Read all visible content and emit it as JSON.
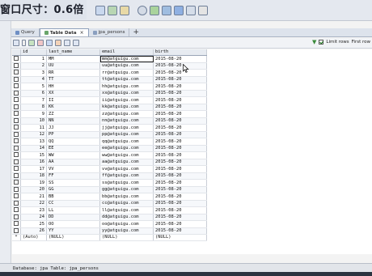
{
  "overlay": {
    "text": "窗口尺寸：0.6倍"
  },
  "tabs": [
    {
      "label": "Query",
      "active": false
    },
    {
      "label": "Table Data",
      "active": true
    },
    {
      "label": "jpa_persons",
      "active": false
    }
  ],
  "grid_toolbar": {
    "limit_label": "Limit rows",
    "first_row_label": "First row"
  },
  "table": {
    "columns": [
      "id",
      "last_name",
      "email",
      "birth"
    ],
    "rows": [
      [
        "1",
        "MM",
        "mm@atguigu.com",
        "2015-08-20"
      ],
      [
        "2",
        "UU",
        "uu@atguigu.com",
        "2015-08-20"
      ],
      [
        "3",
        "RR",
        "rr@atguigu.com",
        "2015-08-20"
      ],
      [
        "4",
        "TT",
        "tt@atguigu.com",
        "2015-08-20"
      ],
      [
        "5",
        "HH",
        "hh@atguigu.com",
        "2015-08-20"
      ],
      [
        "6",
        "XX",
        "xx@atguigu.com",
        "2015-08-20"
      ],
      [
        "7",
        "II",
        "ii@atguigu.com",
        "2015-08-20"
      ],
      [
        "8",
        "KK",
        "kk@atguigu.com",
        "2015-08-20"
      ],
      [
        "9",
        "ZZ",
        "zz@atguigu.com",
        "2015-08-20"
      ],
      [
        "10",
        "NN",
        "nn@atguigu.com",
        "2015-08-20"
      ],
      [
        "11",
        "JJ",
        "jj@atguigu.com",
        "2015-08-20"
      ],
      [
        "12",
        "PP",
        "pp@atguigu.com",
        "2015-08-20"
      ],
      [
        "13",
        "QQ",
        "qq@atguigu.com",
        "2015-08-20"
      ],
      [
        "14",
        "EE",
        "ee@atguigu.com",
        "2015-08-20"
      ],
      [
        "15",
        "WW",
        "ww@atguigu.com",
        "2015-08-20"
      ],
      [
        "16",
        "AA",
        "aa@atguigu.com",
        "2015-08-20"
      ],
      [
        "17",
        "VV",
        "vv@atguigu.com",
        "2015-08-20"
      ],
      [
        "18",
        "FF",
        "ff@atguigu.com",
        "2015-08-20"
      ],
      [
        "19",
        "SS",
        "ss@atguigu.com",
        "2015-08-20"
      ],
      [
        "20",
        "GG",
        "gg@atguigu.com",
        "2015-08-20"
      ],
      [
        "21",
        "BB",
        "bb@atguigu.com",
        "2015-08-20"
      ],
      [
        "22",
        "CC",
        "cc@atguigu.com",
        "2015-08-20"
      ],
      [
        "23",
        "LL",
        "ll@atguigu.com",
        "2015-08-20"
      ],
      [
        "24",
        "DD",
        "dd@atguigu.com",
        "2015-08-20"
      ],
      [
        "25",
        "OO",
        "oo@atguigu.com",
        "2015-08-20"
      ],
      [
        "26",
        "YY",
        "yy@atguigu.com",
        "2015-08-20"
      ]
    ],
    "new_row": [
      "*",
      "(Auto)",
      "(NULL)",
      "(NULL)",
      "(NULL)"
    ],
    "selected": {
      "row": 0,
      "col": 2
    }
  },
  "status": {
    "text": "Database: jpa  Table: jpa_persons"
  },
  "colors": {
    "tab_active": "#ffffff",
    "header_bg": "#e7ebf1",
    "status_bg": "#e2e5ea"
  }
}
